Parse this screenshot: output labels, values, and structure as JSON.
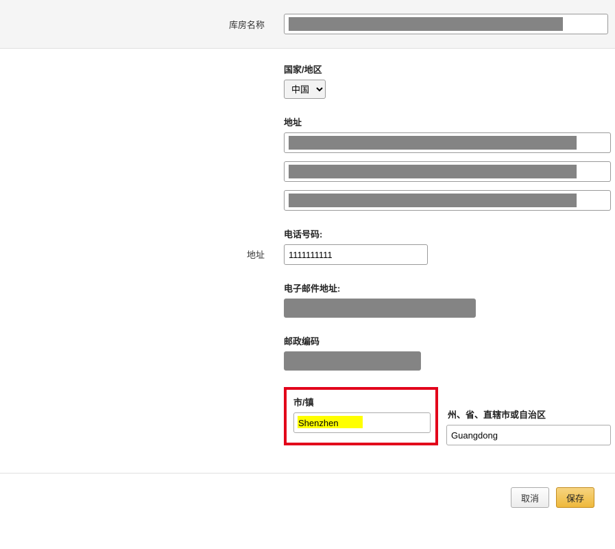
{
  "form": {
    "warehouse_name_label": "库房名称",
    "address_section_label": "地址",
    "country_region_label": "国家/地区",
    "country_value": "中国",
    "address_label": "地址",
    "phone_label": "电话号码:",
    "phone_value": "1111111111",
    "email_label": "电子邮件地址:",
    "postal_label": "邮政编码",
    "city_label": "市/镇",
    "city_value": "Shenzhen",
    "state_label": "州、省、直辖市或自治区",
    "state_value": "Guangdong"
  },
  "buttons": {
    "cancel": "取消",
    "save": "保存"
  }
}
